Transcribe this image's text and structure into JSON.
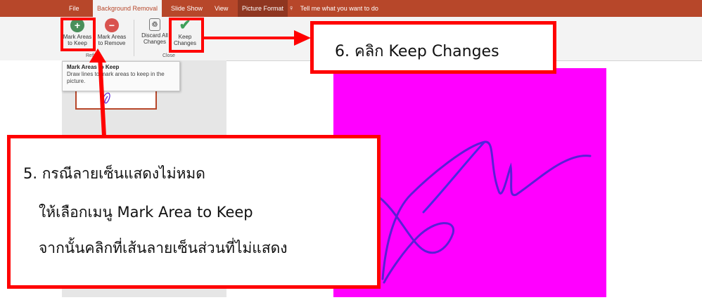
{
  "ribbon_tabs": {
    "file": "File",
    "background_removal": "Background Removal",
    "slide_show": "Slide Show",
    "view": "View",
    "picture_format": "Picture Format",
    "tell_me": "Tell me what you want to do"
  },
  "ribbon": {
    "mark_keep_l1": "Mark Areas",
    "mark_keep_l2": "to Keep",
    "mark_remove_l1": "Mark Areas",
    "mark_remove_l2": "to Remove",
    "discard_l1": "Discard All",
    "discard_l2": "Changes",
    "keep_l1": "Keep",
    "keep_l2": "Changes",
    "group_refine": "Refine",
    "group_close": "Close"
  },
  "tooltip": {
    "title": "Mark Areas to Keep",
    "body": "Draw lines to mark areas to keep in the picture."
  },
  "callouts": {
    "step6": "6. คลิก Keep Changes",
    "step5_line1": "5. กรณีลายเซ็นแสดงไม่หมด",
    "step5_line2": "ให้เลือกเมนู Mark Area to Keep",
    "step5_line3": "จากนั้นคลิกที่เส้นลายเซ็นส่วนที่ไม่แสดง"
  },
  "colors": {
    "accent": "#b7472a",
    "picture_bg": "#ff00ff",
    "signature": "#5a1fd6",
    "callout_border": "#ff0000"
  }
}
